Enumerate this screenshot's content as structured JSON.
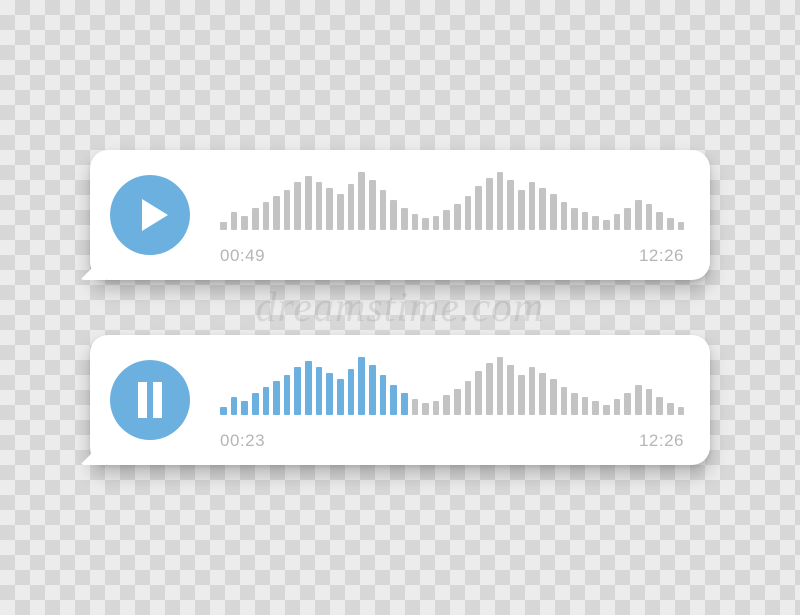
{
  "colors": {
    "accent": "#6cb0e0",
    "bar_inactive": "#c3c3c3",
    "bar_active": "#6cb0e0"
  },
  "watermark": "dreamstime.com",
  "waveform_heights": [
    8,
    18,
    14,
    22,
    28,
    34,
    40,
    48,
    54,
    48,
    42,
    36,
    46,
    58,
    50,
    40,
    30,
    22,
    16,
    12,
    14,
    20,
    26,
    34,
    44,
    52,
    58,
    50,
    40,
    48,
    42,
    36,
    28,
    22,
    18,
    14,
    10,
    16,
    22,
    30,
    26,
    18,
    12,
    8
  ],
  "messages": [
    {
      "state": "paused",
      "icon": "play",
      "elapsed": "00:49",
      "total": "12:26",
      "active_bars": 0
    },
    {
      "state": "playing",
      "icon": "pause",
      "elapsed": "00:23",
      "total": "12:26",
      "active_bars": 18
    }
  ]
}
